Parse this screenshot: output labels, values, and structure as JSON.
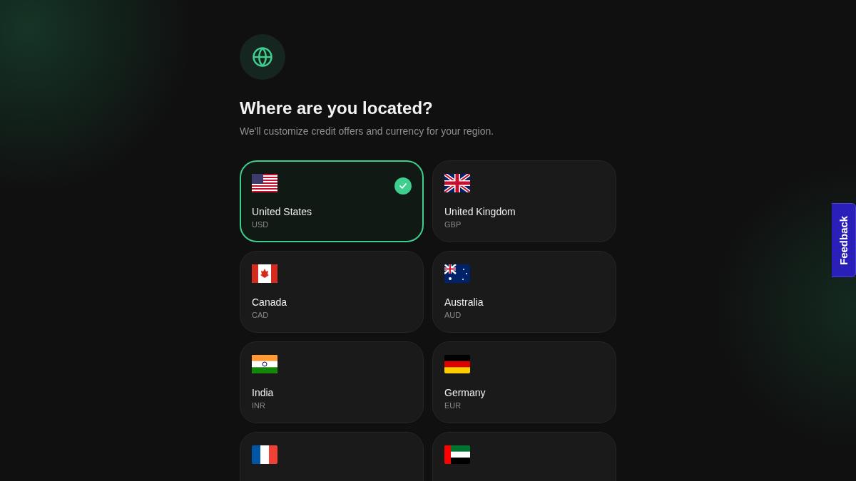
{
  "header": {
    "title": "Where are you located?",
    "subtitle": "We'll customize credit offers and currency for your region."
  },
  "countries": [
    {
      "kind": "us",
      "name": "United States",
      "currency": "USD",
      "selected": true
    },
    {
      "kind": "gb",
      "name": "United Kingdom",
      "currency": "GBP",
      "selected": false
    },
    {
      "kind": "ca",
      "name": "Canada",
      "currency": "CAD",
      "selected": false
    },
    {
      "kind": "au",
      "name": "Australia",
      "currency": "AUD",
      "selected": false
    },
    {
      "kind": "in",
      "name": "India",
      "currency": "INR",
      "selected": false
    },
    {
      "kind": "de",
      "name": "Germany",
      "currency": "EUR",
      "selected": false
    },
    {
      "kind": "fr",
      "selected": false
    },
    {
      "kind": "ae",
      "selected": false
    }
  ],
  "feedback": {
    "label": "Feedback"
  }
}
